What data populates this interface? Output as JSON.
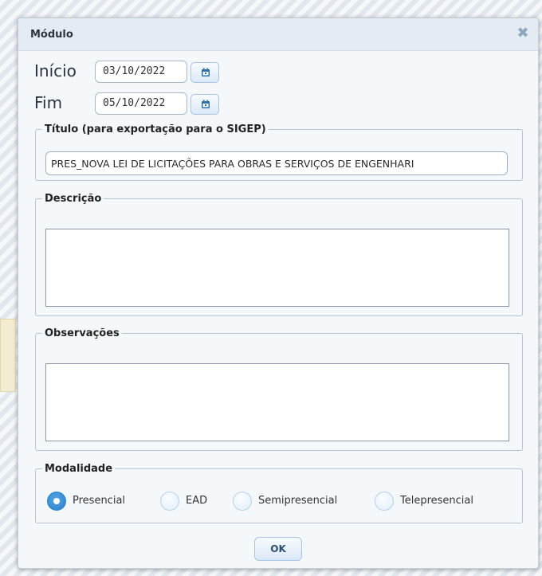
{
  "dialog": {
    "title": "Módulo",
    "close_icon": "close-icon"
  },
  "dates": {
    "inicio_label": "Início",
    "inicio_value": "03/10/2022",
    "fim_label": "Fim",
    "fim_value": "05/10/2022",
    "calendar_icon": "calendar-icon"
  },
  "titulo": {
    "legend": "Título (para exportação para o SIGEP)",
    "value": "PRES_NOVA LEI DE LICITAÇÕES PARA OBRAS E SERVIÇOS DE ENGENHARI"
  },
  "descricao": {
    "legend": "Descrição",
    "value": ""
  },
  "observacoes": {
    "legend": "Observações",
    "value": ""
  },
  "modalidade": {
    "legend": "Modalidade",
    "options": [
      "Presencial",
      "EAD",
      "Semipresencial",
      "Telepresencial"
    ],
    "selected": "Presencial"
  },
  "actions": {
    "ok_label": "OK"
  },
  "colors": {
    "accent": "#2b7dc7",
    "dialog_bg": "#f5f8fb",
    "titlebar_bg": "#e4ebf2",
    "close_icon": "#8da5bd"
  }
}
